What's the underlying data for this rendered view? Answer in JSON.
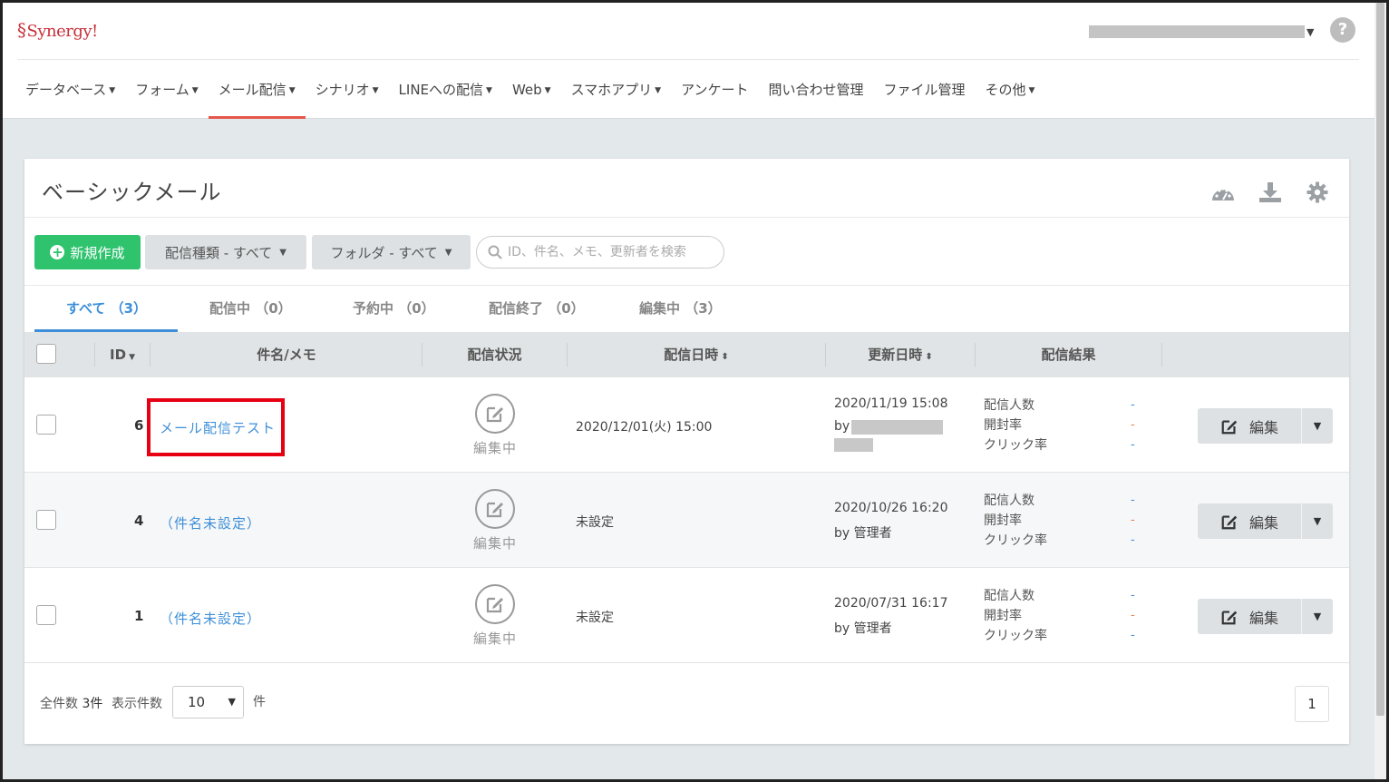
{
  "app": {
    "logo": "Synergy!"
  },
  "nav": [
    {
      "label": "データベース",
      "caret": true
    },
    {
      "label": "フォーム",
      "caret": true
    },
    {
      "label": "メール配信",
      "caret": true,
      "active": true
    },
    {
      "label": "シナリオ",
      "caret": true
    },
    {
      "label": "LINEへの配信",
      "caret": true
    },
    {
      "label": "Web",
      "caret": true
    },
    {
      "label": "スマホアプリ",
      "caret": true
    },
    {
      "label": "アンケート",
      "caret": false
    },
    {
      "label": "問い合わせ管理",
      "caret": false
    },
    {
      "label": "ファイル管理",
      "caret": false
    },
    {
      "label": "その他",
      "caret": true
    }
  ],
  "help_label": "?",
  "page_title": "ベーシックメール",
  "toolbar": {
    "new_label": "新規作成",
    "type_filter": "配信種類 - すべて",
    "folder_filter": "フォルダ - すべて",
    "search_placeholder": "ID、件名、メモ、更新者を検索"
  },
  "tabs": [
    {
      "label": "すべて （3）",
      "active": true
    },
    {
      "label": "配信中 （0）"
    },
    {
      "label": "予約中 （0）"
    },
    {
      "label": "配信終了 （0）"
    },
    {
      "label": "編集中 （3）"
    }
  ],
  "table": {
    "headers": {
      "id": "ID",
      "subject": "件名/メモ",
      "status": "配信状況",
      "send_date": "配信日時",
      "updated": "更新日時",
      "result": "配信結果"
    },
    "metric_labels": [
      "配信人数",
      "開封率",
      "クリック率"
    ],
    "rows": [
      {
        "id": "6",
        "subject": "メール配信テスト",
        "status": "編集中",
        "send_date": "2020/12/01(火) 15:00",
        "updated": "2020/11/19 15:08",
        "by": "by",
        "metrics": [
          "-",
          "-",
          "-"
        ],
        "edit": "編集"
      },
      {
        "id": "4",
        "subject": "（件名未設定）",
        "status": "編集中",
        "send_date": "未設定",
        "updated": "2020/10/26 16:20",
        "by": "by 管理者",
        "metrics": [
          "-",
          "-",
          "-"
        ],
        "edit": "編集"
      },
      {
        "id": "1",
        "subject": "（件名未設定）",
        "status": "編集中",
        "send_date": "未設定",
        "updated": "2020/07/31 16:17",
        "by": "by 管理者",
        "metrics": [
          "-",
          "-",
          "-"
        ],
        "edit": "編集"
      }
    ]
  },
  "footer": {
    "total_label": "全件数",
    "total_value": "3件",
    "per_page_label": "表示件数",
    "per_page_value": "10",
    "unit": "件",
    "page": "1"
  },
  "colors": {
    "accent": "#3e8fd8",
    "primary_button": "#2fc36e",
    "nav_active": "#e5564c",
    "highlight": "#e60012"
  }
}
